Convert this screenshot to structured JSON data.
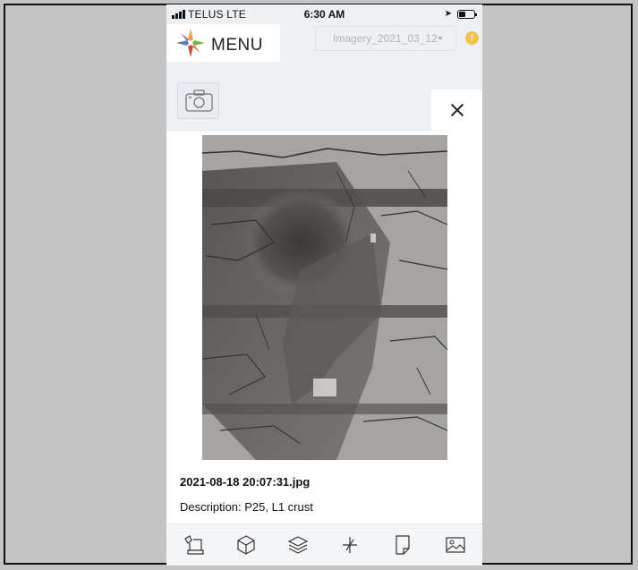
{
  "status_bar": {
    "carrier": "TELUS  LTE",
    "time": "6:30 AM"
  },
  "header": {
    "menu_label": "MENU",
    "imagery_select": "Imagery_2021_03_12",
    "alert_symbol": "!"
  },
  "colors": {
    "alert": "#f2c14e",
    "panel_bg": "#ffffff",
    "app_bg": "#eef1f4"
  },
  "photo_viewer": {
    "image_subject": "cracked dry mud crust with shovel pit",
    "filename": "2021-08-18 20:07:31.jpg",
    "description": "Description: P25, L1 crust"
  },
  "toolbar": {
    "icons": [
      "excavator-icon",
      "cube-icon",
      "layers-icon",
      "crosshair-icon",
      "document-icon",
      "image-icon"
    ]
  }
}
